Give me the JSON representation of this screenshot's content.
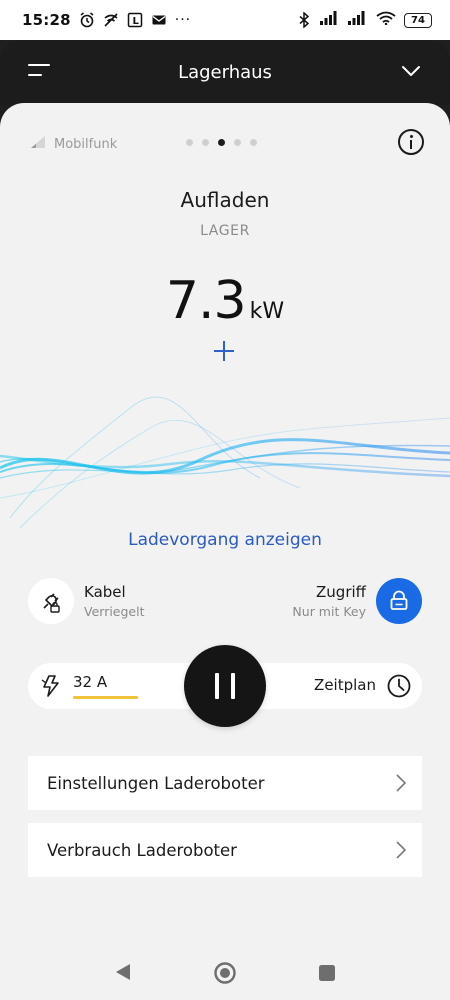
{
  "status_bar": {
    "time": "15:28",
    "left_icons": [
      "alarm-icon",
      "signal-off-icon",
      "app-l-icon",
      "mail-icon",
      "more-icon"
    ],
    "more_text": "···",
    "app_icon_letter": "L",
    "right_icons": [
      "bluetooth-icon",
      "cellular-signal-1-icon",
      "cellular-signal-2-icon",
      "wifi-icon"
    ],
    "battery": "74"
  },
  "header": {
    "title": "Lagerhaus",
    "left_icon": "hamburger-menu-icon",
    "right_icon": "chevron-down-icon"
  },
  "device": {
    "connection_label": "Mobilfunk",
    "pager_total": 5,
    "pager_active": 2,
    "state": "Aufladen",
    "location": "LAGER",
    "power_value": "7.3",
    "power_unit": "kW",
    "show_session_link": "Ladevorgang anzeigen"
  },
  "cable": {
    "title": "Kabel",
    "status": "Verriegelt",
    "icon": "plug-lock-icon"
  },
  "access": {
    "title": "Zugriff",
    "status": "Nur mit Key",
    "icon": "lock-key-icon"
  },
  "controls": {
    "current": "32 A",
    "current_icon": "bolt-icon",
    "pause_icon": "pause-icon",
    "schedule_label": "Zeitplan",
    "schedule_icon": "clock-icon"
  },
  "menu_rows": [
    {
      "label": "Einstellungen Laderoboter"
    },
    {
      "label": "Verbrauch Laderoboter"
    }
  ],
  "nav": {
    "back_icon": "back-triangle-icon",
    "home_icon": "home-circle-icon",
    "recents_icon": "recents-square-icon"
  },
  "colors": {
    "accent_blue": "#1a6ae6",
    "link_blue": "#2a5bbd",
    "current_bar": "#f0c33a",
    "header_bg": "#1c1c1c",
    "card_bg": "#f2f2f2",
    "wave_cyan": "#21c6f0"
  }
}
